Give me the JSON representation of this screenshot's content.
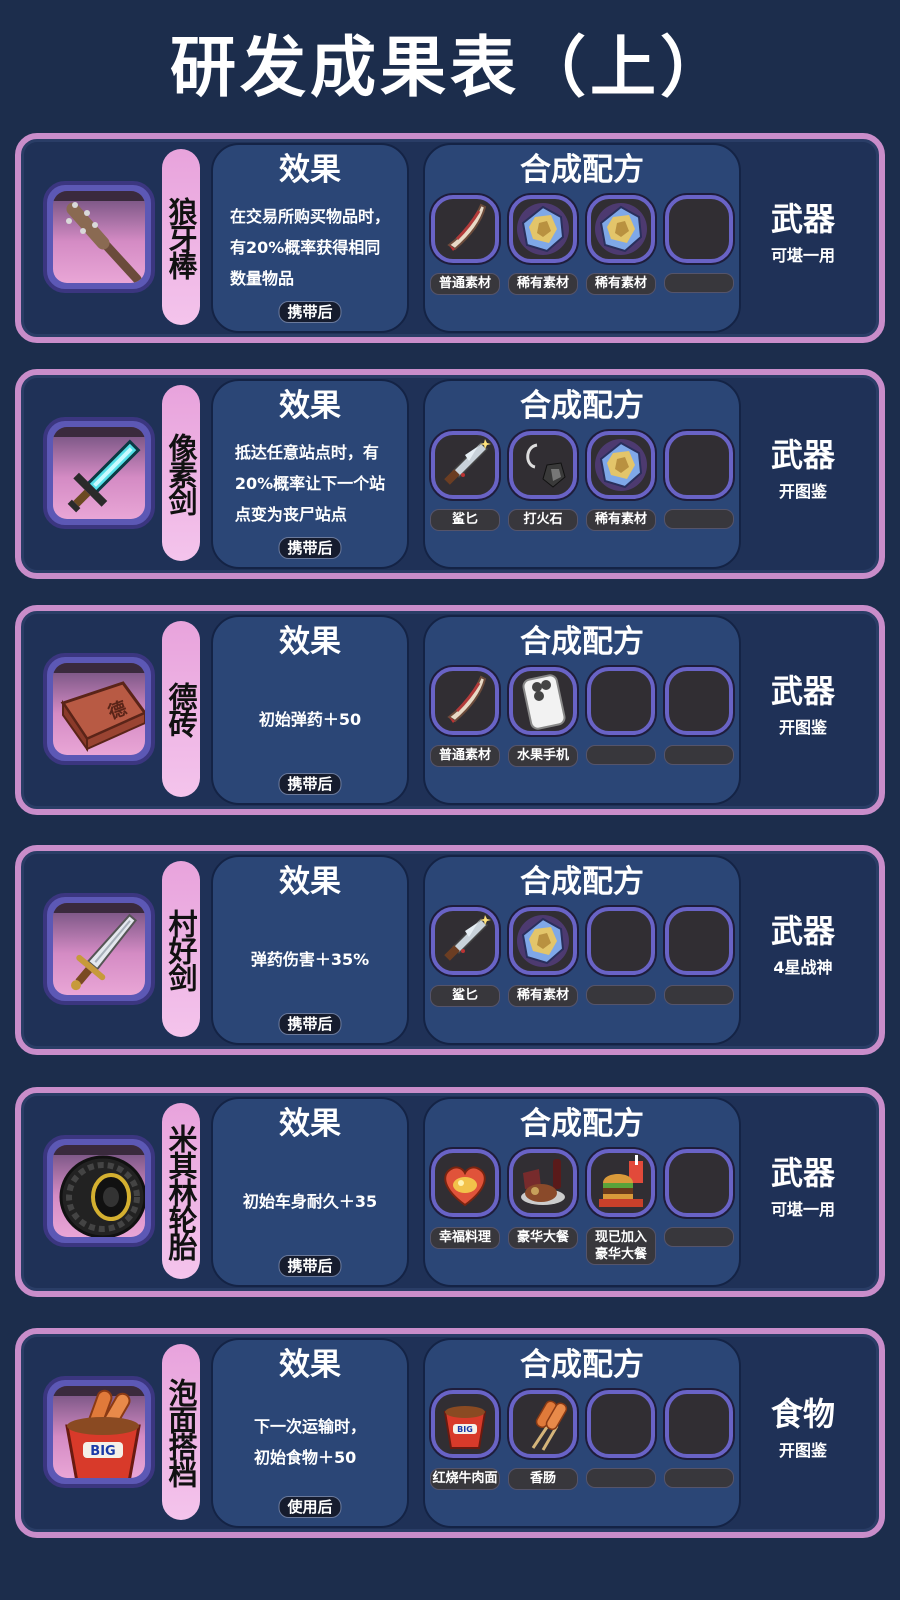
{
  "title": "研发成果表（上）",
  "effect_heading": "效果",
  "recipe_heading": "合成配方",
  "items": [
    {
      "name": "狼牙棒",
      "effect_lines": [
        "在交易所购买物品时，",
        "有20%概率获得相同",
        "数量物品"
      ],
      "condition": "携带后",
      "recipe": [
        {
          "icon": "horn-icon",
          "label": "普通素材"
        },
        {
          "icon": "rare-crystal-icon",
          "label": "稀有素材"
        },
        {
          "icon": "rare-crystal-icon",
          "label": "稀有素材"
        },
        {
          "icon": "",
          "label": ""
        }
      ],
      "category": "武器",
      "category_note": "可堪一用",
      "thumb_icon": "spiked-club-icon"
    },
    {
      "name": "像素剑",
      "effect_lines": [
        "抵达任意站点时，有",
        "20%概率让下一个站",
        "点变为丧尸站点"
      ],
      "condition": "携带后",
      "recipe": [
        {
          "icon": "dagger-icon",
          "label": "鲨匕"
        },
        {
          "icon": "flint-icon",
          "label": "打火石"
        },
        {
          "icon": "rare-crystal-icon",
          "label": "稀有素材"
        },
        {
          "icon": "",
          "label": ""
        }
      ],
      "category": "武器",
      "category_note": "开图鉴",
      "thumb_icon": "pixel-sword-icon"
    },
    {
      "name": "德砖",
      "effect_lines": [
        "初始弹药＋50"
      ],
      "condition": "携带后",
      "recipe": [
        {
          "icon": "horn-icon",
          "label": "普通素材"
        },
        {
          "icon": "phone-icon",
          "label": "水果手机"
        },
        {
          "icon": "",
          "label": ""
        },
        {
          "icon": "",
          "label": ""
        }
      ],
      "category": "武器",
      "category_note": "开图鉴",
      "thumb_icon": "brick-icon"
    },
    {
      "name": "村好剑",
      "effect_lines": [
        "弹药伤害＋35%"
      ],
      "condition": "携带后",
      "recipe": [
        {
          "icon": "dagger-icon",
          "label": "鲨匕"
        },
        {
          "icon": "rare-crystal-icon",
          "label": "稀有素材"
        },
        {
          "icon": "",
          "label": ""
        },
        {
          "icon": "",
          "label": ""
        }
      ],
      "category": "武器",
      "category_note": "4星战神",
      "thumb_icon": "village-sword-icon"
    },
    {
      "name": "米其林轮胎",
      "effect_lines": [
        "初始车身耐久＋35"
      ],
      "condition": "携带后",
      "recipe": [
        {
          "icon": "heart-dish-icon",
          "label": "幸福料理"
        },
        {
          "icon": "feast-icon",
          "label": "豪华大餐"
        },
        {
          "icon": "burger-meal-icon",
          "label": "现已加入豪华大餐"
        },
        {
          "icon": "",
          "label": ""
        }
      ],
      "category": "武器",
      "category_note": "可堪一用",
      "thumb_icon": "tire-icon"
    },
    {
      "name": "泡面搭档",
      "effect_lines": [
        "下一次运输时，",
        "初始食物＋50"
      ],
      "condition": "使用后",
      "recipe": [
        {
          "icon": "noodle-cup-icon",
          "label": "红烧牛肉面"
        },
        {
          "icon": "sausage-icon",
          "label": "香肠"
        },
        {
          "icon": "",
          "label": ""
        },
        {
          "icon": "",
          "label": ""
        }
      ],
      "category": "食物",
      "category_note": "开图鉴",
      "thumb_icon": "noodle-sausage-icon"
    }
  ],
  "colors": {
    "background": "#1c2d4c",
    "card_border": "#c98dca",
    "panel": "#2b4676",
    "slot_border": "#6963c6",
    "name_pill": "#f0b4e6"
  }
}
